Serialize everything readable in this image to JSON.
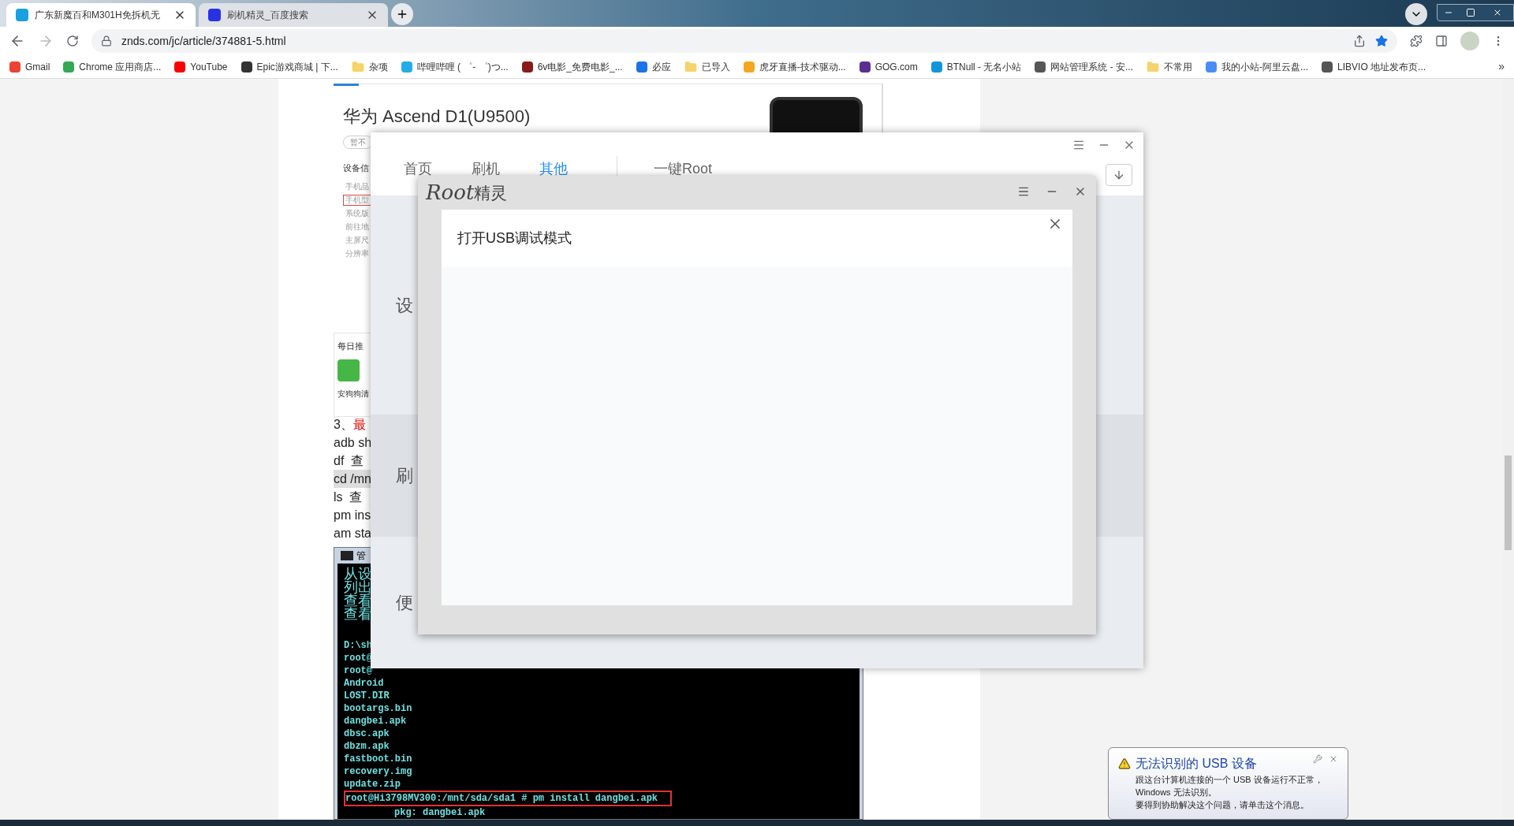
{
  "browser": {
    "tabs": [
      {
        "title": "广东新魔百和M301H免拆机无",
        "selected": true
      },
      {
        "title": "刷机精灵_百度搜索",
        "selected": false
      }
    ],
    "url": "znds.com/jc/article/374881-5.html",
    "bookmarked": true,
    "bookmarks": [
      {
        "label": "Gmail",
        "kind": "site",
        "color": "#ea4335"
      },
      {
        "label": "Chrome 应用商店...",
        "kind": "site",
        "color": "#34a853"
      },
      {
        "label": "YouTube",
        "kind": "site",
        "color": "#ff0000"
      },
      {
        "label": "Epic游戏商城 | 下...",
        "kind": "site",
        "color": "#333333"
      },
      {
        "label": "杂项",
        "kind": "folder",
        "color": "#f6d36b"
      },
      {
        "label": "哔哩哔哩 ( ゜- ゜)つ...",
        "kind": "site",
        "color": "#23ade5"
      },
      {
        "label": "6v电影_免费电影_...",
        "kind": "site",
        "color": "#8b1a1a"
      },
      {
        "label": "必应",
        "kind": "site",
        "color": "#1a73e8"
      },
      {
        "label": "已导入",
        "kind": "folder",
        "color": "#f6d36b"
      },
      {
        "label": "虎牙直播-技术驱动...",
        "kind": "site",
        "color": "#f5a623"
      },
      {
        "label": "GOG.com",
        "kind": "site",
        "color": "#5c2d91"
      },
      {
        "label": "BTNull - 无名小站",
        "kind": "site",
        "color": "#1296db"
      },
      {
        "label": "网站管理系统 - 安...",
        "kind": "site",
        "color": "#555555"
      },
      {
        "label": "不常用",
        "kind": "folder",
        "color": "#f6d36b"
      },
      {
        "label": "我的小站-阿里云盘...",
        "kind": "site",
        "color": "#4a8cf7"
      },
      {
        "label": "LIBVIO 地址发布页...",
        "kind": "site",
        "color": "#555555"
      }
    ],
    "overflow": "»"
  },
  "article": {
    "device_title": "华为 Ascend D1(U9500)",
    "badge": "暂不",
    "card_heading": "设备信",
    "specs": [
      {
        "label": "手机品",
        "selected": false
      },
      {
        "label": "手机型",
        "selected": true
      },
      {
        "label": "系统版",
        "selected": false
      },
      {
        "label": "前往地",
        "selected": false
      },
      {
        "label": "主屏尺",
        "selected": false
      },
      {
        "label": "分辨率",
        "selected": false
      }
    ],
    "daily_heading": "每日推",
    "daily_app": "安狗狗清",
    "lines": [
      {
        "kind": "step",
        "number": "3、",
        "text": "最"
      },
      {
        "kind": "plain",
        "text": "adb sh"
      },
      {
        "kind": "plain",
        "text": "df  查"
      },
      {
        "kind": "shaded",
        "text": "cd /mn"
      },
      {
        "kind": "plain",
        "text": "ls  查"
      },
      {
        "kind": "plain",
        "text": "pm ins"
      },
      {
        "kind": "plain",
        "text": "am sta"
      }
    ],
    "terminal": {
      "title": "管",
      "lines": [
        {
          "kind": "cn",
          "text": "从设"
        },
        {
          "kind": "cn",
          "text": "列出"
        },
        {
          "kind": "cn",
          "text": "查看"
        },
        {
          "kind": "cn",
          "text": "查看"
        },
        {
          "kind": "gap",
          "text": "D:\\sh"
        },
        {
          "kind": "plain",
          "text": "root@"
        },
        {
          "kind": "plain",
          "text": "root@"
        },
        {
          "kind": "plain",
          "text": "Android"
        },
        {
          "kind": "plain",
          "text": "LOST.DIR"
        },
        {
          "kind": "plain",
          "text": "bootargs.bin"
        },
        {
          "kind": "plain",
          "text": "dangbei.apk"
        },
        {
          "kind": "plain",
          "text": "dbsc.apk"
        },
        {
          "kind": "plain",
          "text": "dbzm.apk"
        },
        {
          "kind": "plain",
          "text": "fastboot.bin"
        },
        {
          "kind": "plain",
          "text": "recovery.img"
        },
        {
          "kind": "plain",
          "text": "update.zip"
        },
        {
          "kind": "boxed",
          "text": "root@Hi3798MV300:/mnt/sda/sda1 # pm install dangbei.apk"
        },
        {
          "kind": "indented",
          "text": "pkg: dangbei.apk"
        }
      ]
    }
  },
  "app_window": {
    "tabs": [
      {
        "label": "首页",
        "selected": false
      },
      {
        "label": "刷机",
        "selected": false
      },
      {
        "label": "其他",
        "selected": true
      }
    ],
    "root_button": "一键Root",
    "sections": [
      "设",
      "刷",
      "便"
    ]
  },
  "dialog": {
    "logo_latin": "Root",
    "logo_cn": "精灵",
    "panel_title": "打开USB调试模式"
  },
  "notification": {
    "title": "无法识别的 USB 设备",
    "lines": [
      "跟这台计算机连接的一个 USB 设备运行不正常，",
      "Windows 无法识别。",
      "要得到协助解决这个问题，请单击这个消息。"
    ]
  }
}
